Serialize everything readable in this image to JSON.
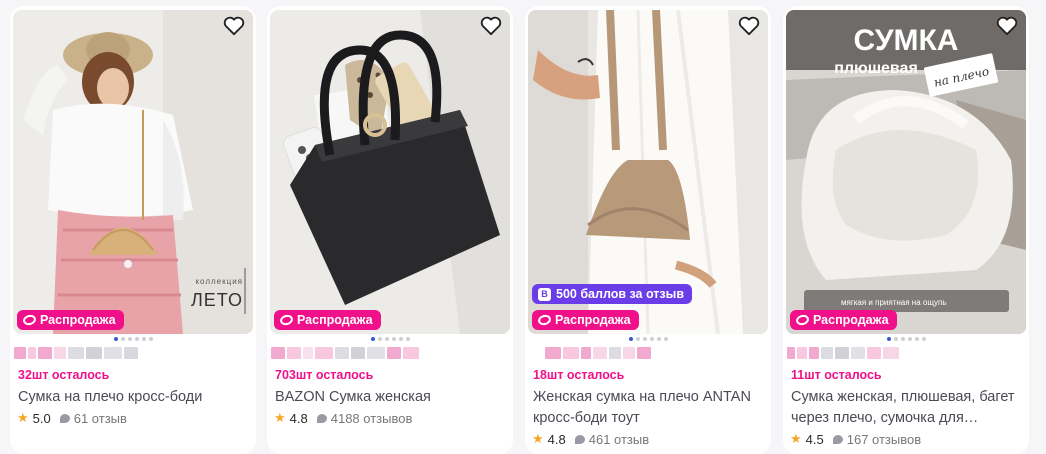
{
  "products": [
    {
      "stock": "32шт осталось",
      "title": "Сумка на плечо кросс-боди",
      "rating": "5.0",
      "reviews": "61 отзыв",
      "sale": "Распродажа",
      "overlay": [
        "коллекция",
        "ЛЕТО"
      ]
    },
    {
      "stock": "703шт осталось",
      "title": "BAZON Сумка женская",
      "rating": "4.8",
      "reviews": "4188 отзывов",
      "sale": "Распродажа"
    },
    {
      "stock": "18шт осталось",
      "title": "Женская сумка на плечо ANTAN кросс-боди тоут",
      "rating": "4.8",
      "reviews": "461 отзыв",
      "sale": "Распродажа",
      "points": "500 баллов за отзыв",
      "points_icon": "В"
    },
    {
      "stock": "11шт осталось",
      "title": "Сумка женская, плюшевая, багет через плечо, сумочка для…",
      "rating": "4.5",
      "reviews": "167 отзывов",
      "sale": "Распродажа",
      "overlay": [
        "СУМКА",
        "плюшевая",
        "на плечо",
        "мягкая и приятная на ощупь"
      ]
    }
  ],
  "colors": {
    "accent_pink": "#f0118a",
    "points_purple": "#6a3de8",
    "star": "#f5a623"
  },
  "icons": [
    "heart-icon",
    "star-icon",
    "comment-bubble-icon",
    "sale-ring-icon"
  ]
}
